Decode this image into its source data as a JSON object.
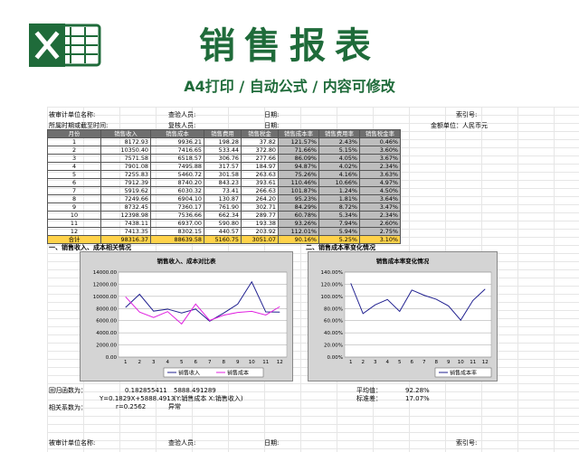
{
  "header": {
    "title": "销售报表",
    "subtitle": "A4打印 / 自动公式 / 内容可修改"
  },
  "form": {
    "audited_unit": "被审计单位名称:",
    "auditor": "查验人员:",
    "date1": "日期:",
    "index_no": "索引号:",
    "period": "所属时期或截至时间:",
    "reviewer": "复核人员:",
    "date2": "日期:",
    "unit": "金额单位：人民币元"
  },
  "table": {
    "headers": [
      "月份",
      "销售收入",
      "销售成本",
      "销售费用",
      "销售税金",
      "销售成本率",
      "销售费用率",
      "销售税金率"
    ],
    "rows": [
      [
        "1",
        "8172.93",
        "9936.21",
        "198.28",
        "37.82",
        "121.57%",
        "2.43%",
        "0.46%"
      ],
      [
        "2",
        "10350.40",
        "7416.65",
        "533.44",
        "372.80",
        "71.66%",
        "5.15%",
        "3.60%"
      ],
      [
        "3",
        "7571.58",
        "6518.57",
        "306.76",
        "277.66",
        "86.09%",
        "4.05%",
        "3.67%"
      ],
      [
        "4",
        "7901.08",
        "7495.88",
        "317.57",
        "184.97",
        "94.87%",
        "4.02%",
        "2.34%"
      ],
      [
        "5",
        "7255.83",
        "5460.72",
        "301.58",
        "263.63",
        "75.26%",
        "4.16%",
        "3.63%"
      ],
      [
        "6",
        "7912.39",
        "8740.20",
        "843.23",
        "393.61",
        "110.46%",
        "10.66%",
        "4.97%"
      ],
      [
        "7",
        "5919.62",
        "6030.32",
        "73.41",
        "266.63",
        "101.87%",
        "1.24%",
        "4.50%"
      ],
      [
        "8",
        "7249.66",
        "6904.10",
        "130.87",
        "264.20",
        "95.23%",
        "1.81%",
        "3.64%"
      ],
      [
        "9",
        "8732.45",
        "7360.17",
        "761.90",
        "302.71",
        "84.29%",
        "8.72%",
        "3.47%"
      ],
      [
        "10",
        "12398.98",
        "7536.66",
        "662.34",
        "289.77",
        "60.78%",
        "5.34%",
        "2.34%"
      ],
      [
        "11",
        "7438.11",
        "6937.00",
        "590.80",
        "193.38",
        "93.26%",
        "7.94%",
        "2.60%"
      ],
      [
        "12",
        "7413.35",
        "8302.15",
        "440.57",
        "203.92",
        "112.01%",
        "5.94%",
        "2.75%"
      ]
    ],
    "total": [
      "合计",
      "98316.37",
      "88639.58",
      "5160.75",
      "3051.07",
      "90.16%",
      "5.25%",
      "3.10%"
    ]
  },
  "sections": {
    "left": "一、销售收入、成本相关情况",
    "right": "二、销售成本率变化情况"
  },
  "chart_data": [
    {
      "type": "line",
      "title": "销售收入、成本对比表",
      "x": [
        1,
        2,
        3,
        4,
        5,
        6,
        7,
        8,
        9,
        10,
        11,
        12
      ],
      "series": [
        {
          "name": "销售收入",
          "color": "#1f1f8f",
          "values": [
            8172.93,
            10350.4,
            7571.58,
            7901.08,
            7255.83,
            7912.39,
            5919.62,
            7249.66,
            8732.45,
            12398.98,
            7438.11,
            7413.35
          ]
        },
        {
          "name": "销售成本",
          "color": "#e020e0",
          "values": [
            9936.21,
            7416.65,
            6518.57,
            7495.88,
            5460.72,
            8740.2,
            6030.32,
            6904.1,
            7360.17,
            7536.66,
            6937.0,
            8302.15
          ]
        }
      ],
      "yticks": [
        "14000.00",
        "12000.00",
        "10000.00",
        "8000.00",
        "6000.00",
        "4000.00",
        "2000.00",
        "0.00"
      ],
      "xticks": [
        "1",
        "2",
        "3",
        "4",
        "5",
        "6",
        "7",
        "8",
        "9",
        "10",
        "11",
        "12"
      ],
      "ylim": [
        0,
        14000
      ],
      "legend": "bottom"
    },
    {
      "type": "line",
      "title": "销售成本率变化情况",
      "x": [
        1,
        2,
        3,
        4,
        5,
        6,
        7,
        8,
        9,
        10,
        11,
        12
      ],
      "series": [
        {
          "name": "销售成本率",
          "color": "#1f1f8f",
          "values": [
            121.57,
            71.66,
            86.09,
            94.87,
            75.26,
            110.46,
            101.87,
            95.23,
            84.29,
            60.78,
            93.26,
            112.01
          ]
        }
      ],
      "yticks": [
        "140.00%",
        "120.00%",
        "100.00%",
        "80.00%",
        "60.00%",
        "40.00%",
        "20.00%",
        "0.00%"
      ],
      "xticks": [
        "1",
        "2",
        "3",
        "4",
        "5",
        "6",
        "7",
        "8",
        "9",
        "10",
        "11",
        "12"
      ],
      "ylim": [
        0,
        140
      ],
      "legend": "bottom-right"
    }
  ],
  "regression": {
    "label": "回归函数为：",
    "slope": "0.182855411",
    "intercept": "5888.491289",
    "equation": "Y=0.1829X+5888.4913",
    "equation_note": "(Y:销售成本  X:销售收入)",
    "corr_label": "相关系数为：",
    "corr_value": "r=0.2562",
    "corr_note": "异常"
  },
  "stats": {
    "mean_label": "平均值：",
    "mean_value": "92.28%",
    "std_label": "标准差：",
    "std_value": "17.07%"
  },
  "footer": {
    "audited_unit": "被审计单位名称:",
    "auditor": "查验人员:",
    "date": "日期:",
    "index_no": "索引号:"
  },
  "colors": {
    "title_green": "#1f6b3a",
    "header_gray": "#6f6f6f",
    "total_yellow": "#ffd24a",
    "line_revenue": "#1f1f8f",
    "line_cost": "#e020e0"
  }
}
